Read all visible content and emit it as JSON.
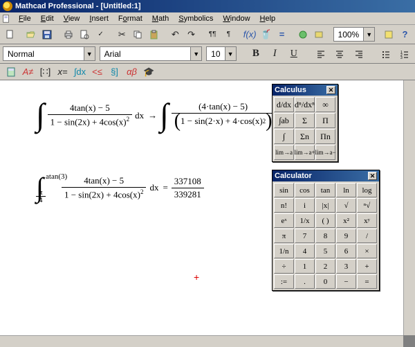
{
  "app_title": "Mathcad Professional - [Untitled:1]",
  "menu": [
    "File",
    "Edit",
    "View",
    "Insert",
    "Format",
    "Math",
    "Symbolics",
    "Window",
    "Help"
  ],
  "toolbar1": {
    "zoom": "100%"
  },
  "format_bar": {
    "style": "Normal",
    "font": "Arial",
    "size": "10",
    "bold": "B",
    "italic": "I",
    "underline": "U"
  },
  "workspace": {
    "expr1": {
      "int_numerator": "4tan(x) − 5",
      "int_denominator_pre": "1 − sin(2x) + 4cos(x)",
      "dx": "dx",
      "arrow": "→",
      "rhs_numerator": "(4·tan(x) − 5)",
      "rhs_denom_inner": "1 − sin(2·x) + 4·cos(x)"
    },
    "expr2": {
      "upper": "atan(3)",
      "lower_num": "π",
      "lower_den": "4",
      "numerator": "4tan(x) − 5",
      "denominator_pre": "1 − sin(2x) + 4cos(x)",
      "dx": "dx",
      "eq": "=",
      "result_num": "337108",
      "result_den": "339281"
    }
  },
  "palettes": {
    "calculus": {
      "title": "Calculus",
      "cells": [
        "d/dx",
        "dⁿ/dxⁿ",
        "∞",
        "∫ab",
        "Σ",
        "Π",
        "∫",
        "Σn",
        "Πn",
        "lim→a",
        "lim→a+",
        "lim→a−"
      ]
    },
    "calculator": {
      "title": "Calculator",
      "cells": [
        "sin",
        "cos",
        "tan",
        "ln",
        "log",
        "n!",
        "i",
        "|x|",
        "√",
        "ⁿ√",
        "eˣ",
        "1/x",
        "( )",
        "x²",
        "xʸ",
        "π",
        "7",
        "8",
        "9",
        "/",
        "1/n",
        "4",
        "5",
        "6",
        "×",
        "÷",
        "1",
        "2",
        "3",
        "+",
        ":=",
        ".",
        "0",
        "−",
        "="
      ]
    }
  }
}
